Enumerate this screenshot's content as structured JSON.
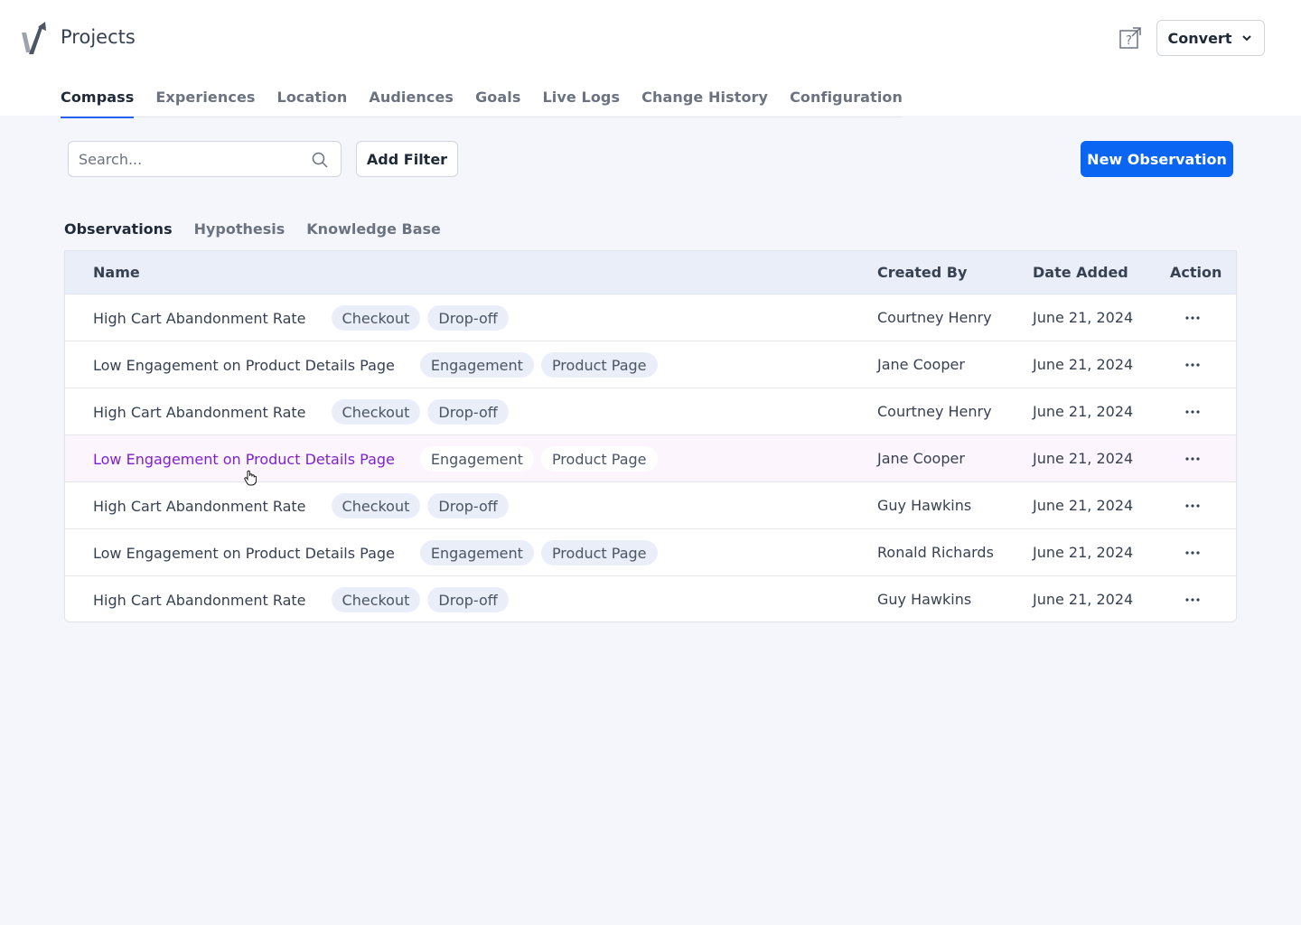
{
  "app": {
    "title": "Projects"
  },
  "header": {
    "convert_label": "Convert"
  },
  "main_nav": [
    {
      "label": "Compass",
      "active": true
    },
    {
      "label": "Experiences"
    },
    {
      "label": "Location"
    },
    {
      "label": "Audiences"
    },
    {
      "label": "Goals"
    },
    {
      "label": "Live Logs"
    },
    {
      "label": "Change History"
    },
    {
      "label": "Configuration"
    }
  ],
  "toolbar": {
    "search_placeholder": "Search...",
    "add_filter_label": "Add Filter",
    "new_observation_label": "New Observation"
  },
  "sub_tabs": [
    {
      "label": "Observations",
      "active": true
    },
    {
      "label": "Hypothesis"
    },
    {
      "label": "Knowledge Base"
    }
  ],
  "table": {
    "headers": {
      "name": "Name",
      "created_by": "Created By",
      "date_added": "Date Added",
      "action": "Action"
    },
    "rows": [
      {
        "name": "High Cart Abandonment Rate",
        "tags": [
          "Checkout",
          "Drop-off"
        ],
        "created_by": "Courtney Henry",
        "date": "June 21, 2024"
      },
      {
        "name": "Low Engagement on Product Details Page",
        "tags": [
          "Engagement",
          "Product Page"
        ],
        "created_by": "Jane Cooper",
        "date": "June 21, 2024"
      },
      {
        "name": "High Cart Abandonment Rate",
        "tags": [
          "Checkout",
          "Drop-off"
        ],
        "created_by": "Courtney Henry",
        "date": "June 21, 2024"
      },
      {
        "name": "Low Engagement on Product Details Page",
        "tags": [
          "Engagement",
          "Product Page"
        ],
        "created_by": "Jane Cooper",
        "date": "June 21, 2024",
        "hovered": true
      },
      {
        "name": "High Cart Abandonment Rate",
        "tags": [
          "Checkout",
          "Drop-off"
        ],
        "created_by": "Guy Hawkins",
        "date": "June 21, 2024"
      },
      {
        "name": "Low Engagement on Product Details Page",
        "tags": [
          "Engagement",
          "Product Page"
        ],
        "created_by": "Ronald Richards",
        "date": "June 21, 2024"
      },
      {
        "name": "High Cart Abandonment Rate",
        "tags": [
          "Checkout",
          "Drop-off"
        ],
        "created_by": "Guy Hawkins",
        "date": "June 21, 2024"
      }
    ]
  },
  "icons": {
    "logo": "logo-icon",
    "help": "help-external-icon",
    "chevron": "chevron-down-icon",
    "search": "search-icon",
    "action": "more-horizontal-icon"
  },
  "colors": {
    "accent": "#0a66f2",
    "hover_row": "#fdf5fd",
    "hover_text": "#7e22ce",
    "tag_bg": "#e9eef8"
  }
}
